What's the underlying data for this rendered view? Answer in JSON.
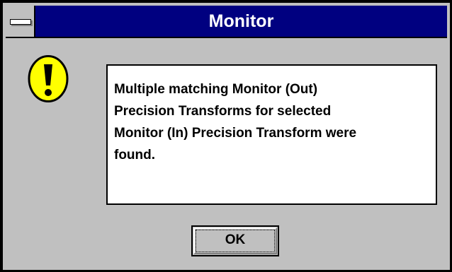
{
  "window": {
    "title": "Monitor",
    "titlebar_color": "#000080",
    "system_menu_icon": "system-menu-icon"
  },
  "icon": {
    "name": "exclamation-icon",
    "color": "#ffff00"
  },
  "message": {
    "lines": [
      "Multiple matching Monitor (Out)",
      "Precision Transforms for selected",
      "Monitor (In) Precision Transform were",
      "found."
    ]
  },
  "buttons": {
    "ok_label": "OK"
  }
}
